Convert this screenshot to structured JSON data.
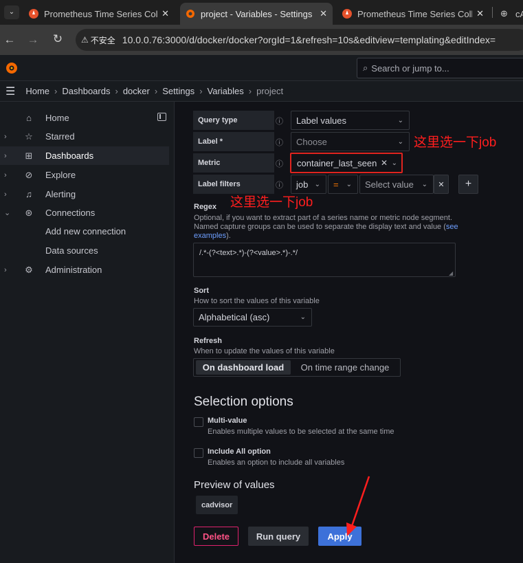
{
  "browser": {
    "tabs": [
      {
        "title": "Prometheus Time Series Colle",
        "close": "✕"
      },
      {
        "title": "project - Variables - Settings",
        "close": "✕"
      },
      {
        "title": "Prometheus Time Series Colle",
        "close": "✕"
      },
      {
        "title": "cA"
      }
    ],
    "security_label": "不安全",
    "url": "10.0.0.76:3000/d/docker/docker?orgId=1&refresh=10s&editview=templating&editIndex="
  },
  "grafana": {
    "search_placeholder": "Search or jump to...",
    "breadcrumbs": [
      "Home",
      "Dashboards",
      "docker",
      "Settings",
      "Variables",
      "project"
    ]
  },
  "sidebar": {
    "items": [
      {
        "label": "Home",
        "icon": "home-icon"
      },
      {
        "label": "Starred",
        "icon": "star-icon"
      },
      {
        "label": "Dashboards",
        "icon": "dashboards-icon"
      },
      {
        "label": "Explore",
        "icon": "compass-icon"
      },
      {
        "label": "Alerting",
        "icon": "bell-icon"
      },
      {
        "label": "Connections",
        "icon": "connections-icon"
      },
      {
        "label": "Add new connection"
      },
      {
        "label": "Data sources"
      },
      {
        "label": "Administration",
        "icon": "gear-icon"
      }
    ]
  },
  "query": {
    "query_type_label": "Query type",
    "query_type_value": "Label values",
    "label_label": "Label *",
    "label_placeholder": "Choose",
    "metric_label": "Metric",
    "metric_value": "container_last_seen",
    "label_filters_label": "Label filters",
    "filter_key": "job",
    "filter_op": "=",
    "filter_value_placeholder": "Select value"
  },
  "annotations": {
    "note1": "这里选一下job",
    "note2": "这里选一下job"
  },
  "regex": {
    "title": "Regex",
    "desc_line1": "Optional, if you want to extract part of a series name or metric node segment.",
    "desc_line2": "Named capture groups can be used to separate the display text and value (",
    "link": "see",
    "link2": "examples",
    "tail": ").",
    "value": "/.*-(?<text>.*)-(?<value>.*)-.*/"
  },
  "sort": {
    "title": "Sort",
    "desc": "How to sort the values of this variable",
    "value": "Alphabetical (asc)"
  },
  "refresh": {
    "title": "Refresh",
    "desc": "When to update the values of this variable",
    "opt1": "On dashboard load",
    "opt2": "On time range change"
  },
  "selection": {
    "heading": "Selection options",
    "multi_title": "Multi-value",
    "multi_desc": "Enables multiple values to be selected at the same time",
    "all_title": "Include All option",
    "all_desc": "Enables an option to include all variables"
  },
  "preview": {
    "heading": "Preview of values",
    "values": [
      "cadvisor"
    ]
  },
  "buttons": {
    "delete": "Delete",
    "run_query": "Run query",
    "apply": "Apply"
  },
  "colors": {
    "accent": "#3d71d9",
    "danger": "#e0226e",
    "annotation": "#ff1e1e"
  }
}
